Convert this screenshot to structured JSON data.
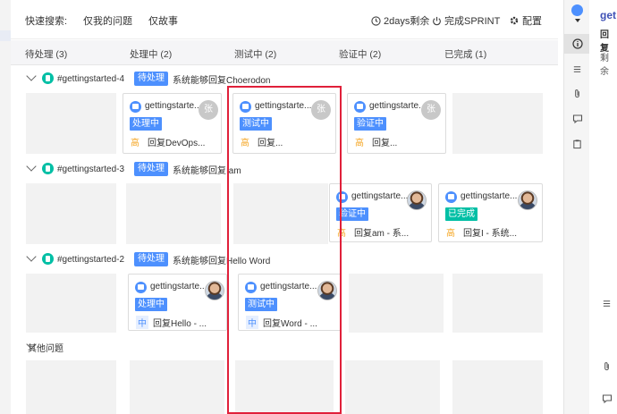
{
  "toolbar": {
    "quick_search_label": "快速搜索:",
    "filter_my_issues": "仅我的问题",
    "filter_stories_only": "仅故事",
    "remaining": "2days剩余",
    "complete_sprint": "完成SPRINT",
    "settings": "配置"
  },
  "columns": [
    "待处理 (3)",
    "处理中 (2)",
    "测试中 (2)",
    "验证中 (2)",
    "已完成 (1)"
  ],
  "swimlanes": [
    {
      "key": "#gettingstarted-4",
      "status": "待处理",
      "summary": "系统能够回复Choerodon"
    },
    {
      "key": "#gettingstarted-3",
      "status": "待处理",
      "summary": "系统能够回复Iam"
    },
    {
      "key": "#gettingstarted-2",
      "status": "待处理",
      "summary": "系统能够回复Hello Word"
    },
    {
      "key": "",
      "status": "",
      "summary": "其他问题"
    }
  ],
  "cards": [
    {
      "key": "gettingstarte...",
      "status": "处理中",
      "priority": "高",
      "summary": "回复DevOps...",
      "avatar": "张"
    },
    {
      "key": "gettingstarte...",
      "status": "测试中",
      "priority": "高",
      "summary": "回复...",
      "avatar": "张"
    },
    {
      "key": "gettingstarte...",
      "status": "验证中",
      "priority": "高",
      "summary": "回复...",
      "avatar": "张"
    },
    {
      "key": "gettingstarte...",
      "status": "验证中",
      "priority": "高",
      "summary": "回复am - 系...",
      "avatar": ""
    },
    {
      "key": "gettingstarte...",
      "status": "已完成",
      "priority": "高",
      "summary": "回复I - 系统...",
      "avatar": ""
    },
    {
      "key": "gettingstarte...",
      "status": "处理中",
      "priority": "中",
      "summary": "回复Hello - ...",
      "avatar": ""
    },
    {
      "key": "gettingstarte...",
      "status": "测试中",
      "priority": "中",
      "summary": "回复Word - ...",
      "avatar": ""
    }
  ],
  "panel": {
    "title": "get",
    "line1": "回复",
    "line2": "剩余"
  },
  "colors": {
    "status_blue": "#4d90fe",
    "status_done": "#00bfa5",
    "priority_high": "#f5a623",
    "priority_medium": "#4d90fe",
    "highlight_red": "#e0203a"
  },
  "icons": [
    "clock-icon",
    "power-icon",
    "gear-icon",
    "chevron-down-icon",
    "issue-type-icon",
    "info-icon",
    "list-icon",
    "attachment-icon",
    "comment-icon",
    "clipboard-icon"
  ]
}
